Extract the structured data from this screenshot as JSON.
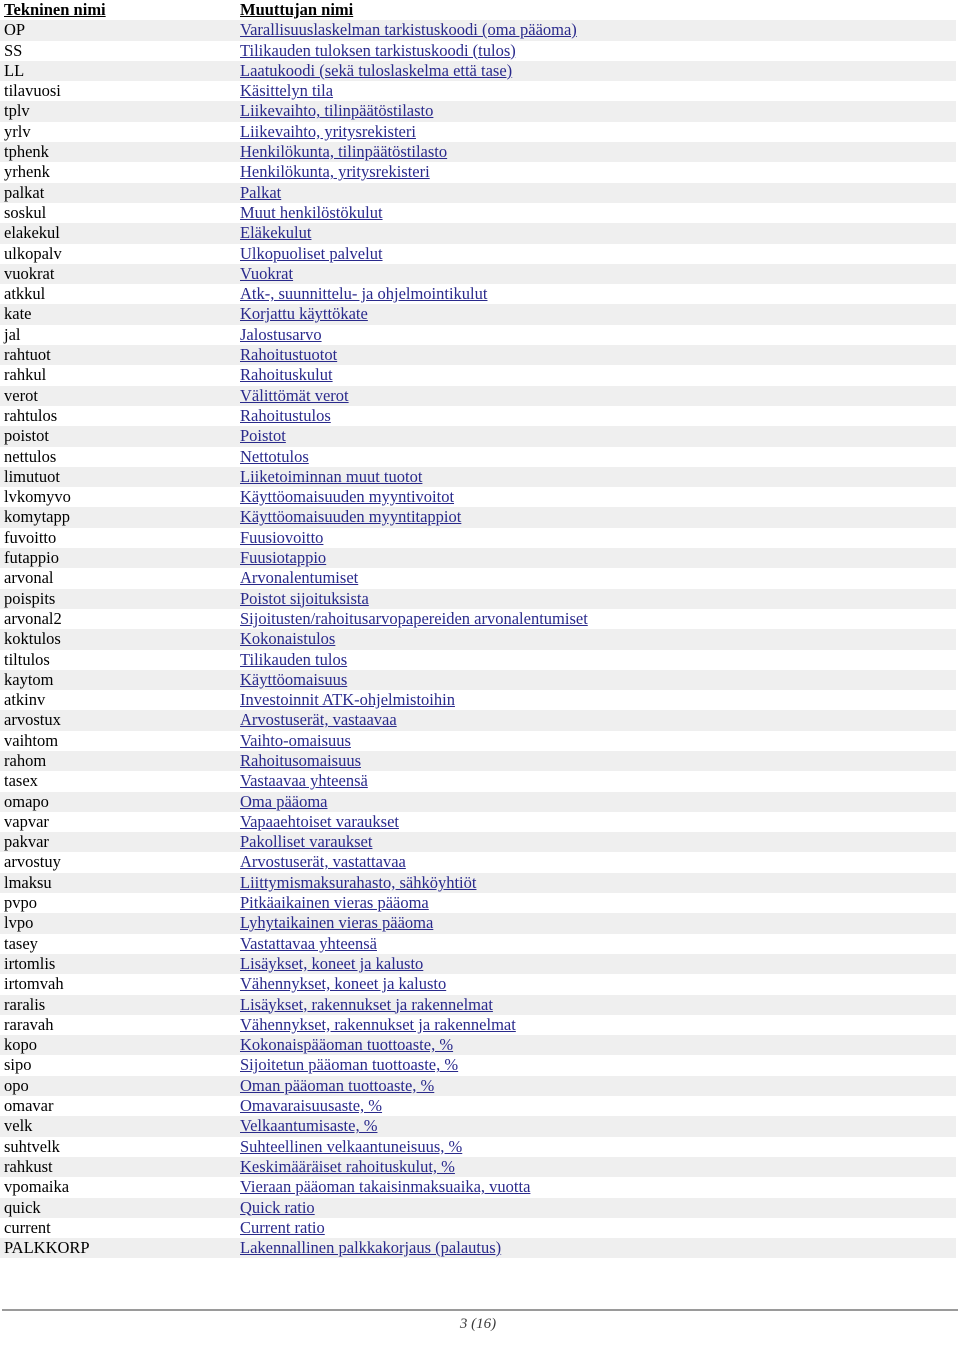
{
  "document": {
    "columns": {
      "technical_name": "Tekninen nimi",
      "variable_name": "Muuttujan nimi"
    },
    "footer": {
      "page_label": "3 (16)"
    },
    "colors": {
      "link": "#2a2a8c",
      "stripe": "#efefef",
      "text": "#000000",
      "rule": "#9a9a9a"
    },
    "rows": [
      {
        "tech": "OP",
        "name": "Varallisuuslaskelman tarkistuskoodi (oma pääoma)"
      },
      {
        "tech": "SS",
        "name": "Tilikauden tuloksen tarkistuskoodi (tulos)"
      },
      {
        "tech": "LL",
        "name": "Laatukoodi (sekä tuloslaskelma että tase)"
      },
      {
        "tech": "tilavuosi",
        "name": "Käsittelyn tila"
      },
      {
        "tech": "tplv",
        "name": "Liikevaihto, tilinpäätöstilasto"
      },
      {
        "tech": "yrlv",
        "name": "Liikevaihto, yritysrekisteri"
      },
      {
        "tech": "tphenk",
        "name": "Henkilökunta, tilinpäätöstilasto"
      },
      {
        "tech": "yrhenk",
        "name": "Henkilökunta, yritysrekisteri"
      },
      {
        "tech": "palkat",
        "name": "Palkat"
      },
      {
        "tech": "soskul",
        "name": "Muut henkilöstökulut"
      },
      {
        "tech": "elakekul",
        "name": "Eläkekulut"
      },
      {
        "tech": "ulkopalv",
        "name": "Ulkopuoliset palvelut"
      },
      {
        "tech": "vuokrat",
        "name": "Vuokrat"
      },
      {
        "tech": "atkkul",
        "name": "Atk-, suunnittelu- ja ohjelmointikulut"
      },
      {
        "tech": "kate",
        "name": "Korjattu käyttökate"
      },
      {
        "tech": "jal",
        "name": "Jalostusarvo"
      },
      {
        "tech": "rahtuot",
        "name": "Rahoitustuotot"
      },
      {
        "tech": "rahkul",
        "name": "Rahoituskulut"
      },
      {
        "tech": "verot",
        "name": "Välittömät verot"
      },
      {
        "tech": "rahtulos",
        "name": "Rahoitustulos"
      },
      {
        "tech": "poistot",
        "name": "Poistot"
      },
      {
        "tech": "nettulos",
        "name": "Nettotulos"
      },
      {
        "tech": "limutuot",
        "name": "Liiketoiminnan muut tuotot"
      },
      {
        "tech": "lvkomyvo",
        "name": "Käyttöomaisuuden myyntivoitot"
      },
      {
        "tech": "komytapp",
        "name": "Käyttöomaisuuden myyntitappiot"
      },
      {
        "tech": "fuvoitto",
        "name": "Fuusiovoitto"
      },
      {
        "tech": "futappio",
        "name": "Fuusiotappio"
      },
      {
        "tech": "arvonal",
        "name": "Arvonalentumiset"
      },
      {
        "tech": "poispits",
        "name": "Poistot sijoituksista"
      },
      {
        "tech": "arvonal2",
        "name": "Sijoitusten/rahoitusarvopapereiden arvonalentumiset"
      },
      {
        "tech": "koktulos",
        "name": "Kokonaistulos"
      },
      {
        "tech": "tiltulos",
        "name": "Tilikauden tulos"
      },
      {
        "tech": "kaytom",
        "name": "Käyttöomaisuus"
      },
      {
        "tech": "atkinv",
        "name": "Investoinnit ATK-ohjelmistoihin"
      },
      {
        "tech": "arvostux",
        "name": "Arvostuserät, vastaavaa"
      },
      {
        "tech": "vaihtom",
        "name": "Vaihto-omaisuus"
      },
      {
        "tech": "rahom",
        "name": "Rahoitusomaisuus"
      },
      {
        "tech": "tasex",
        "name": "Vastaavaa yhteensä"
      },
      {
        "tech": "omapo",
        "name": "Oma pääoma"
      },
      {
        "tech": "vapvar",
        "name": "Vapaaehtoiset varaukset"
      },
      {
        "tech": "pakvar",
        "name": "Pakolliset varaukset"
      },
      {
        "tech": "arvostuy",
        "name": "Arvostuserät, vastattavaa"
      },
      {
        "tech": "lmaksu",
        "name": "Liittymismaksurahasto, sähköyhtiöt"
      },
      {
        "tech": "pvpo",
        "name": "Pitkäaikainen vieras pääoma"
      },
      {
        "tech": "lvpo",
        "name": "Lyhytaikainen vieras pääoma"
      },
      {
        "tech": "tasey",
        "name": "Vastattavaa yhteensä"
      },
      {
        "tech": "irtomlis",
        "name": "Lisäykset, koneet ja kalusto"
      },
      {
        "tech": "irtomvah",
        "name": "Vähennykset, koneet ja kalusto"
      },
      {
        "tech": "raralis",
        "name": "Lisäykset, rakennukset ja rakennelmat"
      },
      {
        "tech": "raravah",
        "name": "Vähennykset, rakennukset ja rakennelmat"
      },
      {
        "tech": "kopo",
        "name": "Kokonaispääoman tuottoaste, %"
      },
      {
        "tech": "sipo",
        "name": "Sijoitetun pääoman tuottoaste, %"
      },
      {
        "tech": "opo",
        "name": "Oman pääoman tuottoaste, %"
      },
      {
        "tech": "omavar",
        "name": "Omavaraisuusaste, %"
      },
      {
        "tech": "velk",
        "name": "Velkaantumisaste, %"
      },
      {
        "tech": "suhtvelk",
        "name": "Suhteellinen velkaantuneisuus, %"
      },
      {
        "tech": "rahkust",
        "name": "Keskimääräiset rahoituskulut, %"
      },
      {
        "tech": "vpomaika",
        "name": "Vieraan pääoman takaisinmaksuaika, vuotta"
      },
      {
        "tech": "quick",
        "name": "Quick ratio"
      },
      {
        "tech": "current",
        "name": "Current ratio"
      },
      {
        "tech": "PALKKORP",
        "name": "Lakennallinen palkkakorjaus (palautus)"
      }
    ]
  }
}
